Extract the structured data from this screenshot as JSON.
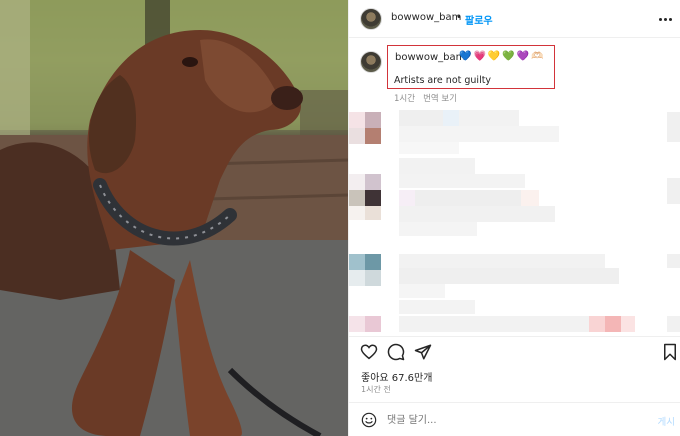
{
  "post": {
    "username": "bowwow_bam",
    "separator": "•",
    "follow_label": "팔로우"
  },
  "comment": {
    "username": "bowwow_bam",
    "hearts": [
      "💙",
      "💗",
      "💛",
      "💚",
      "💜",
      "🫶🏻"
    ],
    "text": "Artists are not guilty",
    "time_ago": "1시간",
    "translate_label": "번역 보기"
  },
  "actions": {
    "likes_text": "좋아요 67.6만개",
    "posted_time": "1시간 전"
  },
  "comment_bar": {
    "placeholder": "댓글 달기...",
    "post_label": "게시"
  },
  "colors": {
    "accent": "#0095f6",
    "highlight_border": "#d2343a",
    "post_disabled": "#b3dbff"
  },
  "icons": [
    "more-icon",
    "heart-icon",
    "comment-icon",
    "share-icon",
    "bookmark-icon",
    "smile-icon"
  ]
}
